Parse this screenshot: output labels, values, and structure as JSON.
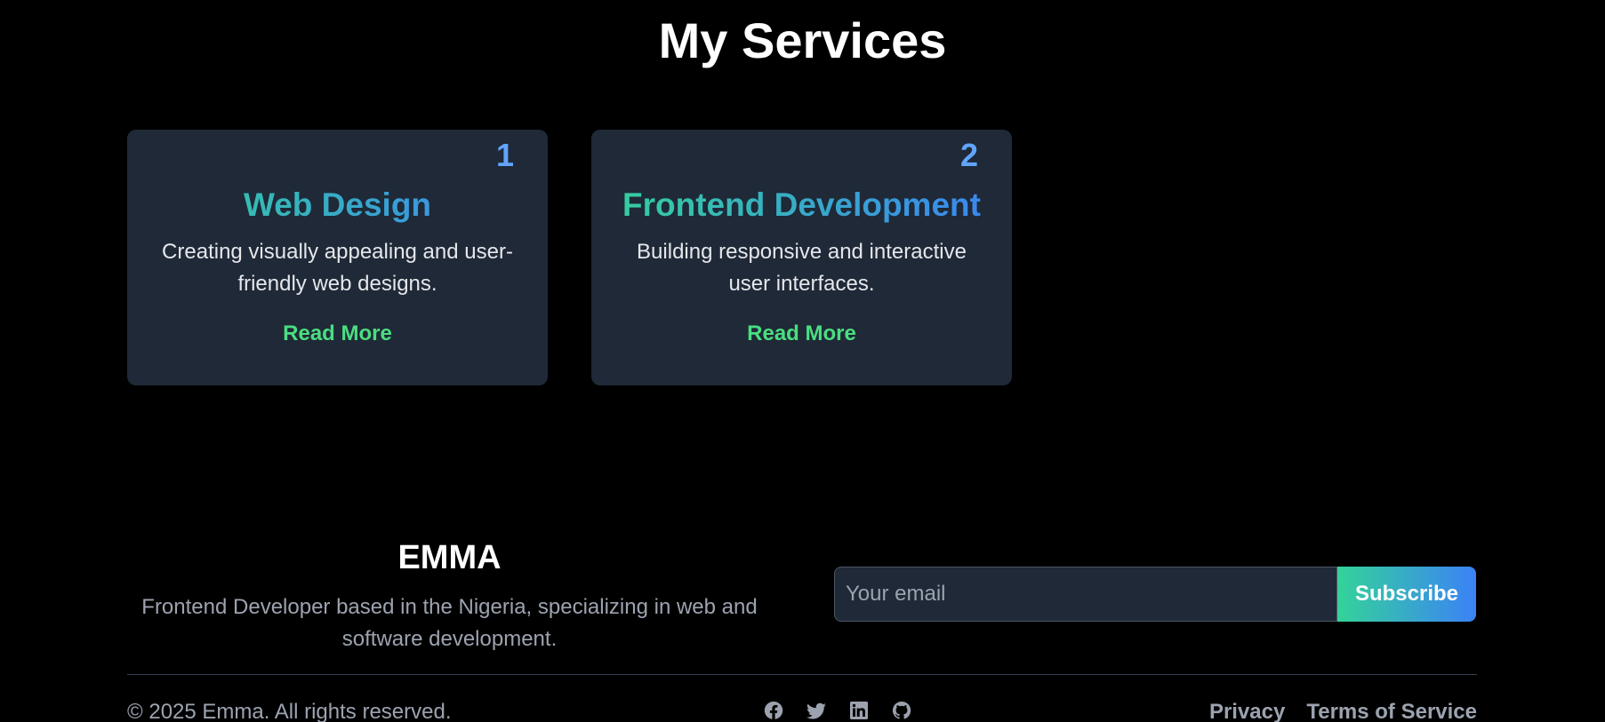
{
  "services": {
    "title": "My Services",
    "cards": [
      {
        "number": "1",
        "title": "Web Design",
        "description": "Creating visually appealing and user-friendly web designs.",
        "link": "Read More"
      },
      {
        "number": "2",
        "title": "Frontend Development",
        "description": "Building responsive and interactive user interfaces.",
        "link": "Read More"
      }
    ]
  },
  "footer": {
    "brand": "EMMA",
    "tagline": "Frontend Developer based in the Nigeria, specializing in web and software development.",
    "email_placeholder": "Your email",
    "subscribe_label": "Subscribe",
    "copyright": "© 2025 Emma. All rights reserved.",
    "socials": [
      "facebook-icon",
      "twitter-icon",
      "linkedin-icon",
      "github-icon"
    ],
    "legal_links": [
      "Privacy",
      "Terms of Service"
    ]
  },
  "colors": {
    "background": "#000000",
    "card": "#1f2937",
    "accent_green": "#4ade80",
    "accent_blue": "#60a5fa",
    "gradient_start": "#34d399",
    "gradient_end": "#3b82f6"
  }
}
